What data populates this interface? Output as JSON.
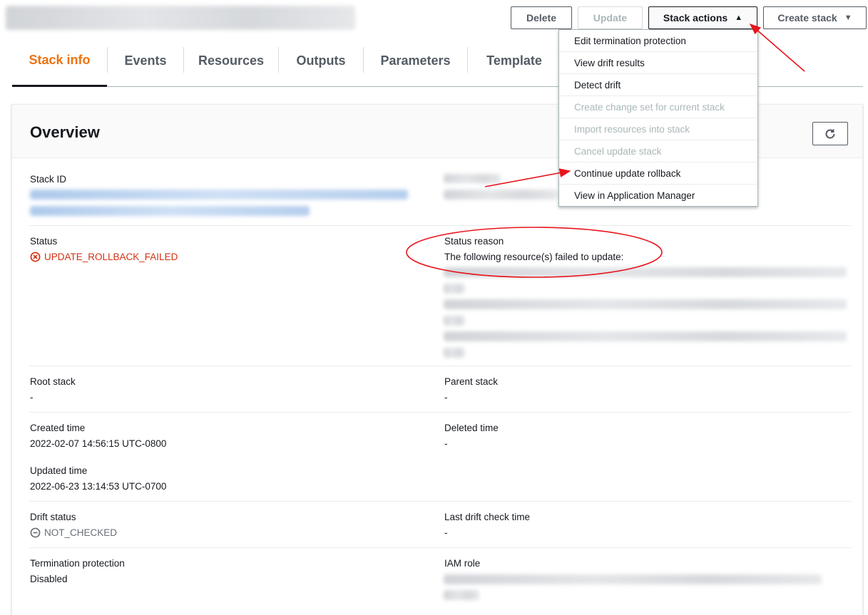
{
  "header": {
    "buttons": {
      "delete": "Delete",
      "update": "Update",
      "stack_actions": "Stack actions",
      "create_stack": "Create stack"
    }
  },
  "tabs": [
    {
      "label": "Stack info",
      "selected": true
    },
    {
      "label": "Events"
    },
    {
      "label": "Resources"
    },
    {
      "label": "Outputs"
    },
    {
      "label": "Parameters"
    },
    {
      "label": "Template"
    }
  ],
  "dropdown": {
    "items": [
      {
        "label": "Edit termination protection",
        "enabled": true
      },
      {
        "label": "View drift results",
        "enabled": true
      },
      {
        "label": "Detect drift",
        "enabled": true
      },
      {
        "label": "Create change set for current stack",
        "enabled": false
      },
      {
        "label": "Import resources into stack",
        "enabled": false
      },
      {
        "label": "Cancel update stack",
        "enabled": false
      },
      {
        "label": "Continue update rollback",
        "enabled": true
      },
      {
        "label": "View in Application Manager",
        "enabled": true
      }
    ]
  },
  "overview": {
    "title": "Overview",
    "stack_id_label": "Stack ID",
    "status_label": "Status",
    "status_value": "UPDATE_ROLLBACK_FAILED",
    "status_reason_label": "Status reason",
    "status_reason_value": "The following resource(s) failed to update:",
    "root_stack_label": "Root stack",
    "root_stack_value": "-",
    "parent_stack_label": "Parent stack",
    "parent_stack_value": "-",
    "created_time_label": "Created time",
    "created_time_value": "2022-02-07 14:56:15 UTC-0800",
    "deleted_time_label": "Deleted time",
    "deleted_time_value": "-",
    "updated_time_label": "Updated time",
    "updated_time_value": "2022-06-23 13:14:53 UTC-0700",
    "drift_status_label": "Drift status",
    "drift_status_value": "NOT_CHECKED",
    "last_drift_label": "Last drift check time",
    "last_drift_value": "-",
    "termination_label": "Termination protection",
    "termination_value": "Disabled",
    "iam_role_label": "IAM role"
  },
  "colors": {
    "accent_tab": "#ec7211",
    "error": "#d13212",
    "annotation": "#e8141b"
  }
}
